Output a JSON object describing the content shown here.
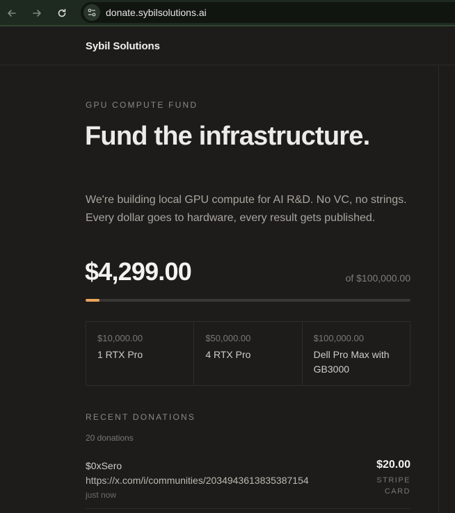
{
  "browser": {
    "url": "donate.sybilsolutions.ai"
  },
  "site": {
    "brand": "Sybil Solutions"
  },
  "hero": {
    "eyebrow": "GPU COMPUTE FUND",
    "headline": "Fund the infrastructure.",
    "lede": "We're building local GPU compute for AI R&D. No VC, no strings. Every dollar goes to hardware, every result gets published."
  },
  "funding": {
    "raised": "$4,299.00",
    "goal": "of $100,000.00",
    "progress_fraction": 0.043,
    "accent_color": "#e8a55c"
  },
  "tiers": [
    {
      "amount": "$10,000.00",
      "name": "1 RTX Pro"
    },
    {
      "amount": "$50,000.00",
      "name": "4 RTX Pro"
    },
    {
      "amount": "$100,000.00",
      "name": "Dell Pro Max with GB3000"
    }
  ],
  "recent": {
    "label": "RECENT DONATIONS",
    "count": "20 donations",
    "items": [
      {
        "donor": "$0xSero",
        "message": "https://x.com/i/communities/2034943613835387154",
        "time": "just now",
        "amount": "$20.00",
        "method": "STRIPE CARD"
      }
    ]
  }
}
